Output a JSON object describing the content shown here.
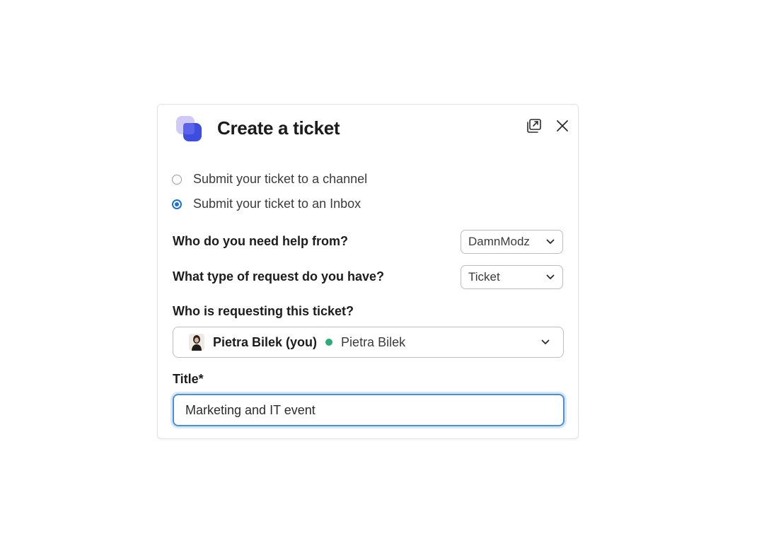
{
  "modal": {
    "title": "Create a ticket",
    "icons": {
      "app_logo": "app-logo-icon",
      "popout": "popout-window-icon",
      "close": "close-icon"
    }
  },
  "destination": {
    "options": [
      {
        "label": "Submit your ticket to a channel",
        "checked": false
      },
      {
        "label": "Submit your ticket to an Inbox",
        "checked": true
      }
    ]
  },
  "help_from": {
    "label": "Who do you need help from?",
    "selected": "DamnModz"
  },
  "request_type": {
    "label": "What type of request do you have?",
    "selected": "Ticket"
  },
  "requester": {
    "label": "Who is requesting this ticket?",
    "name": "Pietra Bilek (you)",
    "display_name": "Pietra Bilek",
    "status_color": "#2bac76"
  },
  "title_field": {
    "label": "Title*",
    "value": "Marketing and IT event"
  },
  "colors": {
    "accent": "#1d6fd8",
    "focus_ring": "#4a90d9",
    "logo_primary": "#3d4de0",
    "logo_secondary": "#b9b4f0"
  }
}
